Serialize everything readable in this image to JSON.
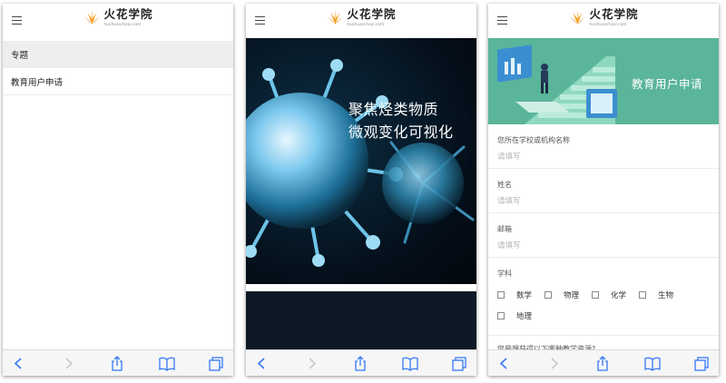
{
  "brand": {
    "name": "火花学院",
    "sub": "huohuaschool.com"
  },
  "screen1": {
    "menu": [
      {
        "label": "专题"
      },
      {
        "label": "教育用户申请"
      }
    ]
  },
  "screen2": {
    "hero_title_line1": "聚焦烃类物质",
    "hero_title_line2": "微观变化可视化"
  },
  "screen3": {
    "banner_title": "教育用户申请",
    "fields": [
      {
        "label": "您所在学校或机构名称",
        "placeholder": "请填写"
      },
      {
        "label": "姓名",
        "placeholder": "请填写"
      },
      {
        "label": "邮箱",
        "placeholder": "请填写"
      }
    ],
    "subject_label": "学科",
    "subjects": [
      "数学",
      "物理",
      "化学",
      "生物",
      "地理"
    ],
    "question": "您最想获得以下哪种教学资源?"
  },
  "colors": {
    "brand_orange": "#f39a1e",
    "banner_green": "#5ab59a",
    "toolbar_blue": "#3478f6"
  }
}
